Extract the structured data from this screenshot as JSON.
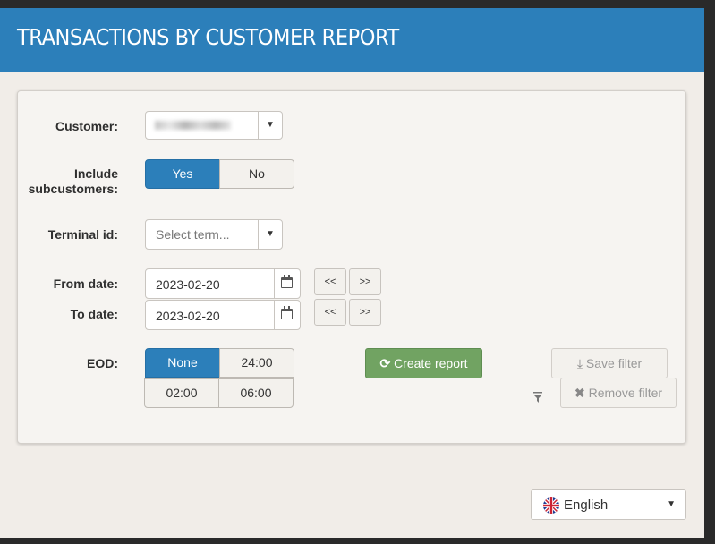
{
  "header": {
    "title": "TRANSACTIONS BY CUSTOMER REPORT"
  },
  "form": {
    "customer": {
      "label": "Customer:",
      "value": ""
    },
    "include_subcustomers": {
      "label_line1": "Include",
      "label_line2": "subcustomers:",
      "options": [
        "Yes",
        "No"
      ],
      "selected": "Yes"
    },
    "terminal": {
      "label": "Terminal id:",
      "placeholder": "Select term..."
    },
    "from_date": {
      "label": "From date:",
      "value": "2023-02-20",
      "prev": "<<",
      "next": ">>"
    },
    "to_date": {
      "label": "To date:",
      "value": "2023-02-20",
      "prev": "<<",
      "next": ">>"
    },
    "eod": {
      "label": "EOD:",
      "options": [
        "None",
        "24:00",
        "02:00",
        "06:00"
      ],
      "selected": "None"
    }
  },
  "actions": {
    "create_report": "Create report",
    "save_filter": "Save filter",
    "remove_filter": "Remove filter"
  },
  "language": {
    "selected": "English"
  },
  "colors": {
    "header": "#2c7fba",
    "active_toggle": "#2c7fba",
    "create_button": "#71a362"
  }
}
